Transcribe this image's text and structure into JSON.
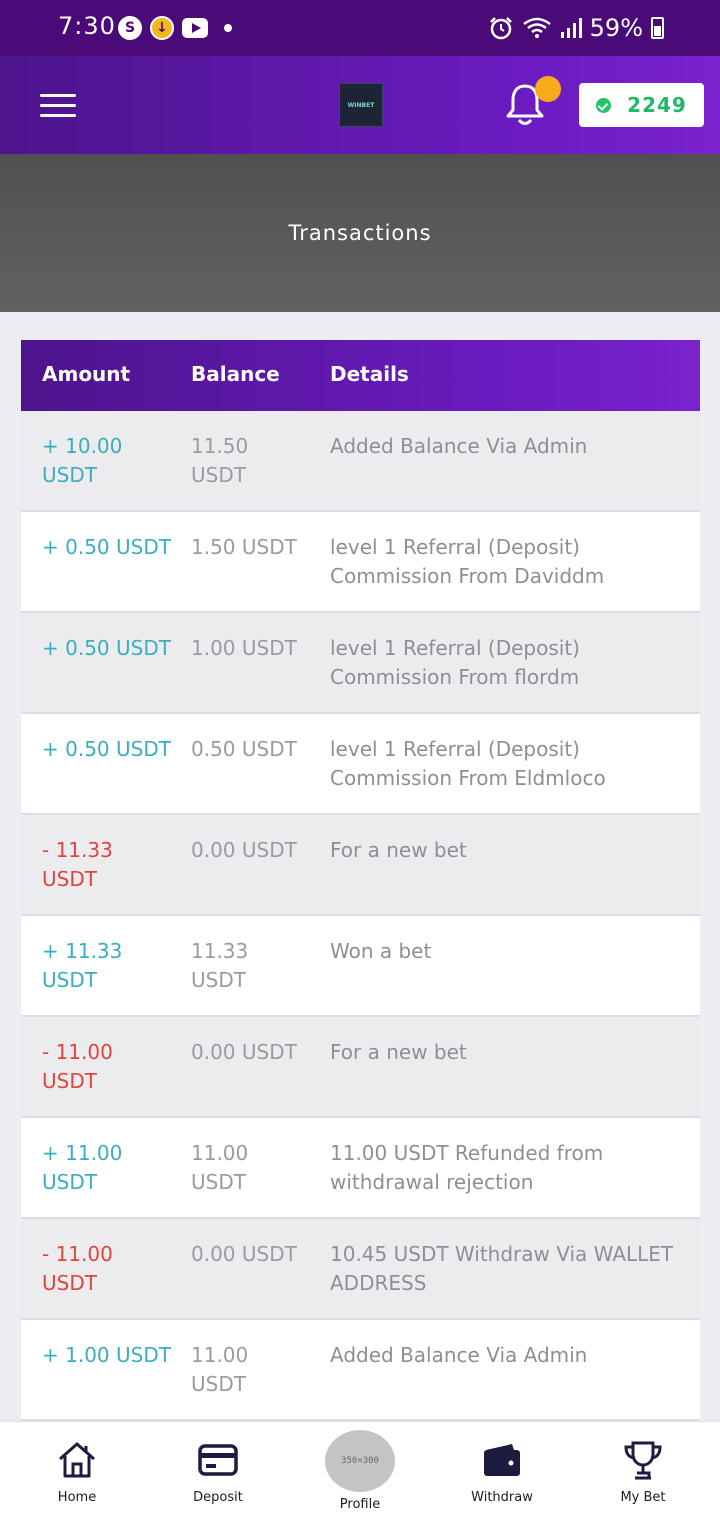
{
  "status_bar": {
    "time": "7:30",
    "battery": "59%",
    "notification_icons": [
      "s-icon",
      "download-icon",
      "youtube-icon",
      "dot-icon"
    ],
    "system_icons": [
      "alarm-icon",
      "wifi-icon",
      "signal-icon",
      "battery-icon"
    ]
  },
  "header": {
    "logo_text": "WINBET",
    "balance": "2249",
    "colors": {
      "gradient_start": "#4d148c",
      "gradient_end": "#7a22cf",
      "notification_dot": "#f6ac1b",
      "balance_green": "#20b868"
    }
  },
  "banner": {
    "title": "Transactions"
  },
  "table": {
    "headers": {
      "amount": "Amount",
      "balance": "Balance",
      "details": "Details"
    },
    "rows": [
      {
        "amount": "+ 10.00 USDT",
        "balance": "11.50 USDT",
        "details": "Added Balance Via Admin",
        "type": "credit"
      },
      {
        "amount": "+ 0.50 USDT",
        "balance": "1.50 USDT",
        "details": "level 1 Referral (Deposit) Commission From Daviddm",
        "type": "credit"
      },
      {
        "amount": "+ 0.50 USDT",
        "balance": "1.00 USDT",
        "details": "level 1 Referral (Deposit) Commission From flordm",
        "type": "credit"
      },
      {
        "amount": "+ 0.50 USDT",
        "balance": "0.50 USDT",
        "details": "level 1 Referral (Deposit) Commission From Eldmloco",
        "type": "credit"
      },
      {
        "amount": "- 11.33 USDT",
        "balance": "0.00 USDT",
        "details": "For a new bet",
        "type": "debit"
      },
      {
        "amount": "+ 11.33 USDT",
        "balance": "11.33 USDT",
        "details": "Won a bet",
        "type": "credit"
      },
      {
        "amount": "- 11.00 USDT",
        "balance": "0.00 USDT",
        "details": "For a new bet",
        "type": "debit"
      },
      {
        "amount": "+ 11.00 USDT",
        "balance": "11.00 USDT",
        "details": "11.00 USDT Refunded from withdrawal rejection",
        "type": "credit"
      },
      {
        "amount": "- 11.00 USDT",
        "balance": "0.00 USDT",
        "details": "10.45 USDT Withdraw Via WALLET ADDRESS",
        "type": "debit"
      },
      {
        "amount": "+ 1.00 USDT",
        "balance": "11.00 USDT",
        "details": "Added Balance Via Admin",
        "type": "credit"
      }
    ],
    "colors": {
      "credit": "#3aaec0",
      "debit": "#e0443e"
    }
  },
  "bottom_nav": {
    "items": [
      {
        "label": "Home",
        "icon": "home-icon"
      },
      {
        "label": "Deposit",
        "icon": "card-icon"
      },
      {
        "label": "Profile",
        "icon": "avatar",
        "placeholder": "350×300"
      },
      {
        "label": "Withdraw",
        "icon": "wallet-icon"
      },
      {
        "label": "My Bet",
        "icon": "trophy-icon"
      }
    ]
  }
}
